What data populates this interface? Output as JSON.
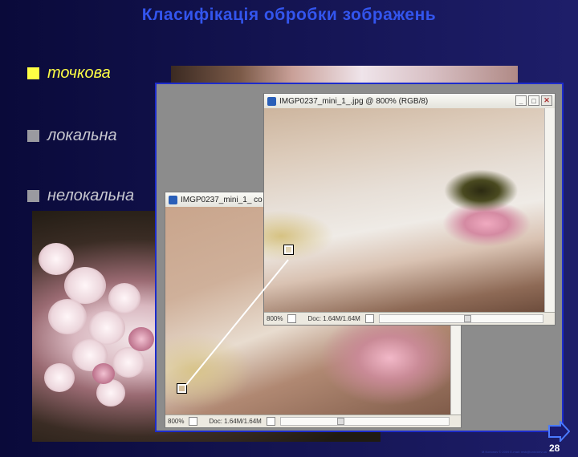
{
  "slide": {
    "title": "Класифікація обробки зображень",
    "bullets": [
      {
        "label": "точкова",
        "highlight": true
      },
      {
        "label": "локальна",
        "highlight": false
      },
      {
        "label": "нелокальна",
        "highlight": false
      }
    ],
    "page_number": "28",
    "footer": "M.Kononov © 2009  E-mail: mvk@univ.kiev.ua"
  },
  "window_front": {
    "title": "IMGP0237_mini_1_.jpg @ 800% (RGB/8)",
    "zoom": "800%",
    "doc_info": "Doc: 1.64M/1.64M",
    "buttons": [
      "minimize",
      "maximize",
      "close"
    ]
  },
  "window_back": {
    "title": "IMGP0237_mini_1_ co",
    "zoom": "800%",
    "doc_info": "Doc: 1.64M/1.64M"
  },
  "colors": {
    "title": "#3355ee",
    "highlight": "#ffff44",
    "panel_border": "#1d2ccc",
    "background": "#141452"
  },
  "icons": {
    "next": "next-arrow-icon",
    "bullet": "square-bullet-icon"
  }
}
